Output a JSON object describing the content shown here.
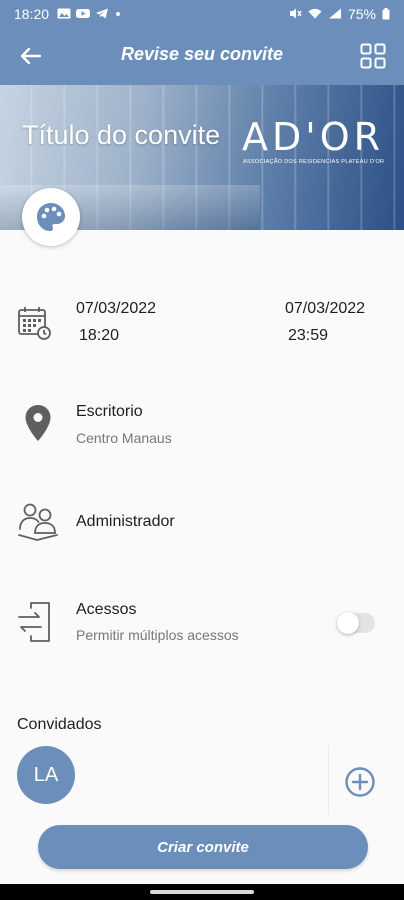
{
  "status_bar": {
    "time": "18:20",
    "battery": "75%"
  },
  "app_bar": {
    "title": "Revise seu convite",
    "back_icon": "arrow-left-icon",
    "grid_icon": "grid-icon"
  },
  "banner": {
    "title": "Título do convite",
    "brand": "AD'OR",
    "brand_subtitle": "ASSOCIAÇÃO DOS RESIDENCIAS PLATEAU D'OR"
  },
  "schedule": {
    "start_date": "07/03/2022",
    "start_time": "18:20",
    "end_date": "07/03/2022",
    "end_time": "23:59"
  },
  "location": {
    "name": "Escritorio",
    "place": "Centro Manaus"
  },
  "host": {
    "label": "Administrador"
  },
  "access": {
    "title": "Acessos",
    "subtitle": "Permitir múltiplos acessos",
    "multiple_enabled": false
  },
  "guests": {
    "label": "Convidados",
    "items": [
      {
        "initials": "LA"
      }
    ]
  },
  "actions": {
    "create_label": "Criar convite"
  },
  "colors": {
    "primary": "#6b8fba",
    "icon_gray": "#5f5f5f"
  }
}
